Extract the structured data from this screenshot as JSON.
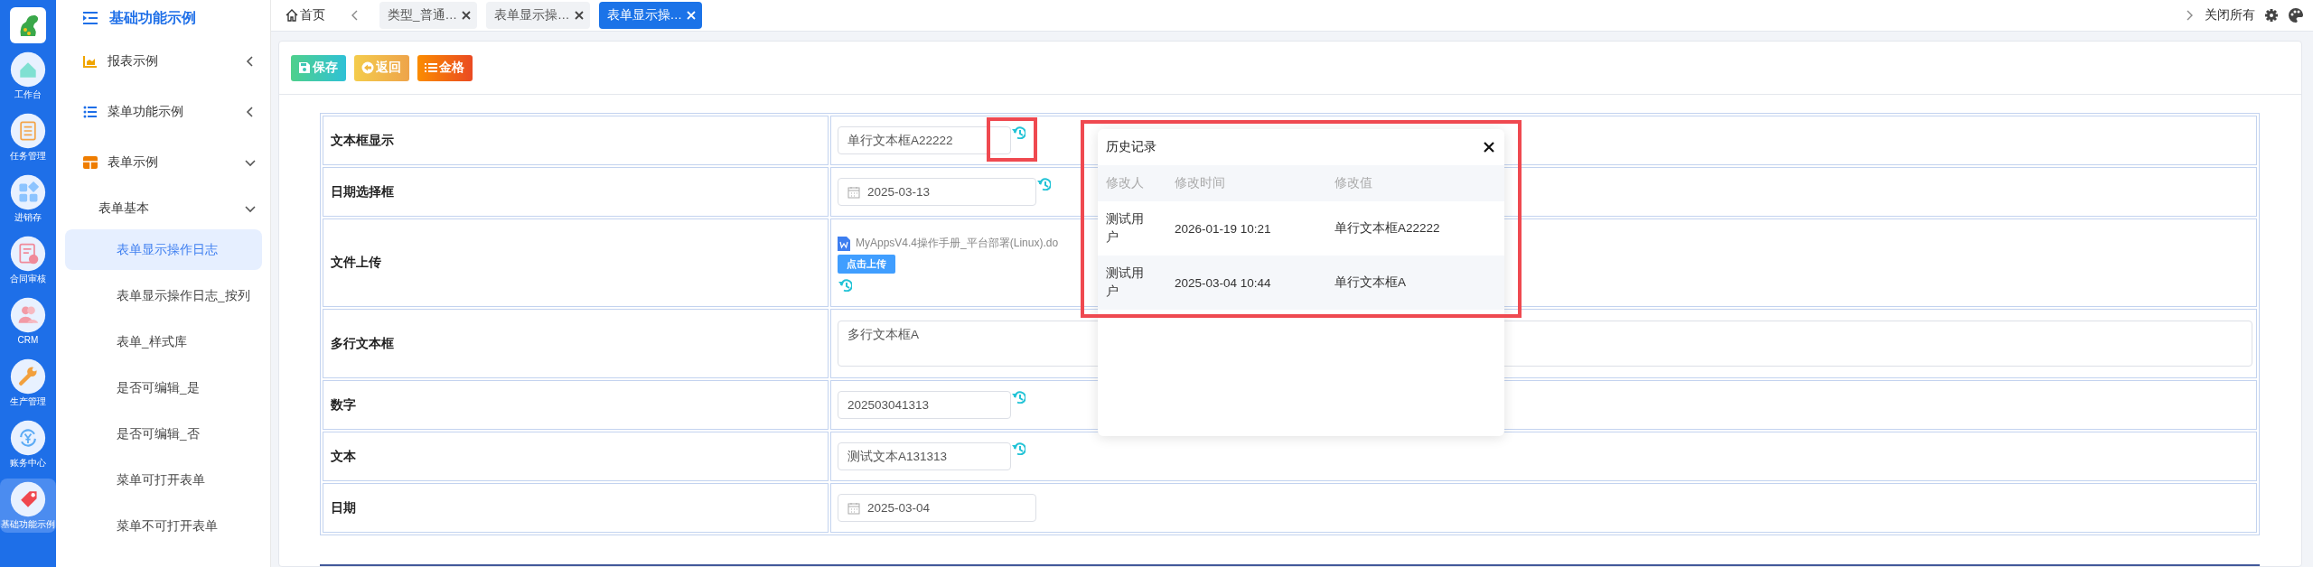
{
  "rail": {
    "items": [
      {
        "label": "工作台",
        "kind": "home",
        "selected": false
      },
      {
        "label": "任务管理",
        "kind": "tasks",
        "selected": false
      },
      {
        "label": "进销存",
        "kind": "grid",
        "selected": false
      },
      {
        "label": "合同审核",
        "kind": "contract",
        "selected": false
      },
      {
        "label": "CRM",
        "kind": "people",
        "selected": false
      },
      {
        "label": "生产管理",
        "kind": "wrench",
        "selected": false
      },
      {
        "label": "账务中心",
        "kind": "cycle",
        "selected": false
      },
      {
        "label": "基础功能示例",
        "kind": "tag",
        "selected": true
      }
    ]
  },
  "sidebar": {
    "title": "基础功能示例",
    "items": [
      {
        "label": "报表示例",
        "kind": "chart",
        "expanded": false
      },
      {
        "label": "菜单功能示例",
        "kind": "list",
        "expanded": false
      },
      {
        "label": "表单示例",
        "kind": "table",
        "expanded": true,
        "children": [
          {
            "label": "表单基本",
            "expanded": true,
            "children": [
              {
                "label": "表单显示操作日志",
                "selected": true
              },
              {
                "label": "表单显示操作日志_按列",
                "selected": false
              },
              {
                "label": "表单_样式库",
                "selected": false
              },
              {
                "label": "是否可编辑_是",
                "selected": false
              },
              {
                "label": "是否可编辑_否",
                "selected": false
              },
              {
                "label": "菜单可打开表单",
                "selected": false
              },
              {
                "label": "菜单不可打开表单",
                "selected": false
              }
            ]
          }
        ]
      }
    ]
  },
  "tab_bar": {
    "home": "首页",
    "tabs": [
      {
        "label": "类型_普通…",
        "selected": false
      },
      {
        "label": "表单显示操…",
        "selected": false
      },
      {
        "label": "表单显示操…",
        "selected": true
      }
    ],
    "close_all": "关闭所有"
  },
  "toolbar": {
    "buttons": [
      {
        "label": "保存",
        "kind": "save"
      },
      {
        "label": "返回",
        "kind": "back"
      },
      {
        "label": "金格",
        "kind": "list"
      }
    ]
  },
  "form": {
    "rows": [
      {
        "label": "文本框显示",
        "kind": "text",
        "value": "单行文本框A22222",
        "history": true
      },
      {
        "label": "日期选择框",
        "kind": "date",
        "value": "2025-03-13",
        "history": true
      },
      {
        "label": "文件上传",
        "kind": "file",
        "file_name": "MyAppsV4.4操作手册_平台部署(Linux).do",
        "upload_button": "点击上传",
        "history": true
      },
      {
        "label": "多行文本框",
        "kind": "textarea",
        "value": "多行文本框A",
        "history": false
      },
      {
        "label": "数字",
        "kind": "text",
        "value": "202503041313",
        "history": true
      },
      {
        "label": "文本",
        "kind": "text",
        "value": "测试文本A131313",
        "history": true
      },
      {
        "label": "日期",
        "kind": "date",
        "value": "2025-03-04",
        "history": false
      }
    ]
  },
  "history_popup": {
    "title": "历史记录",
    "columns": [
      "修改人",
      "修改时间",
      "修改值"
    ],
    "rows": [
      [
        "测试用户",
        "2026-01-19 10:21",
        "单行文本框A22222"
      ],
      [
        "测试用户",
        "2025-03-04 10:44",
        "单行文本框A"
      ]
    ]
  }
}
